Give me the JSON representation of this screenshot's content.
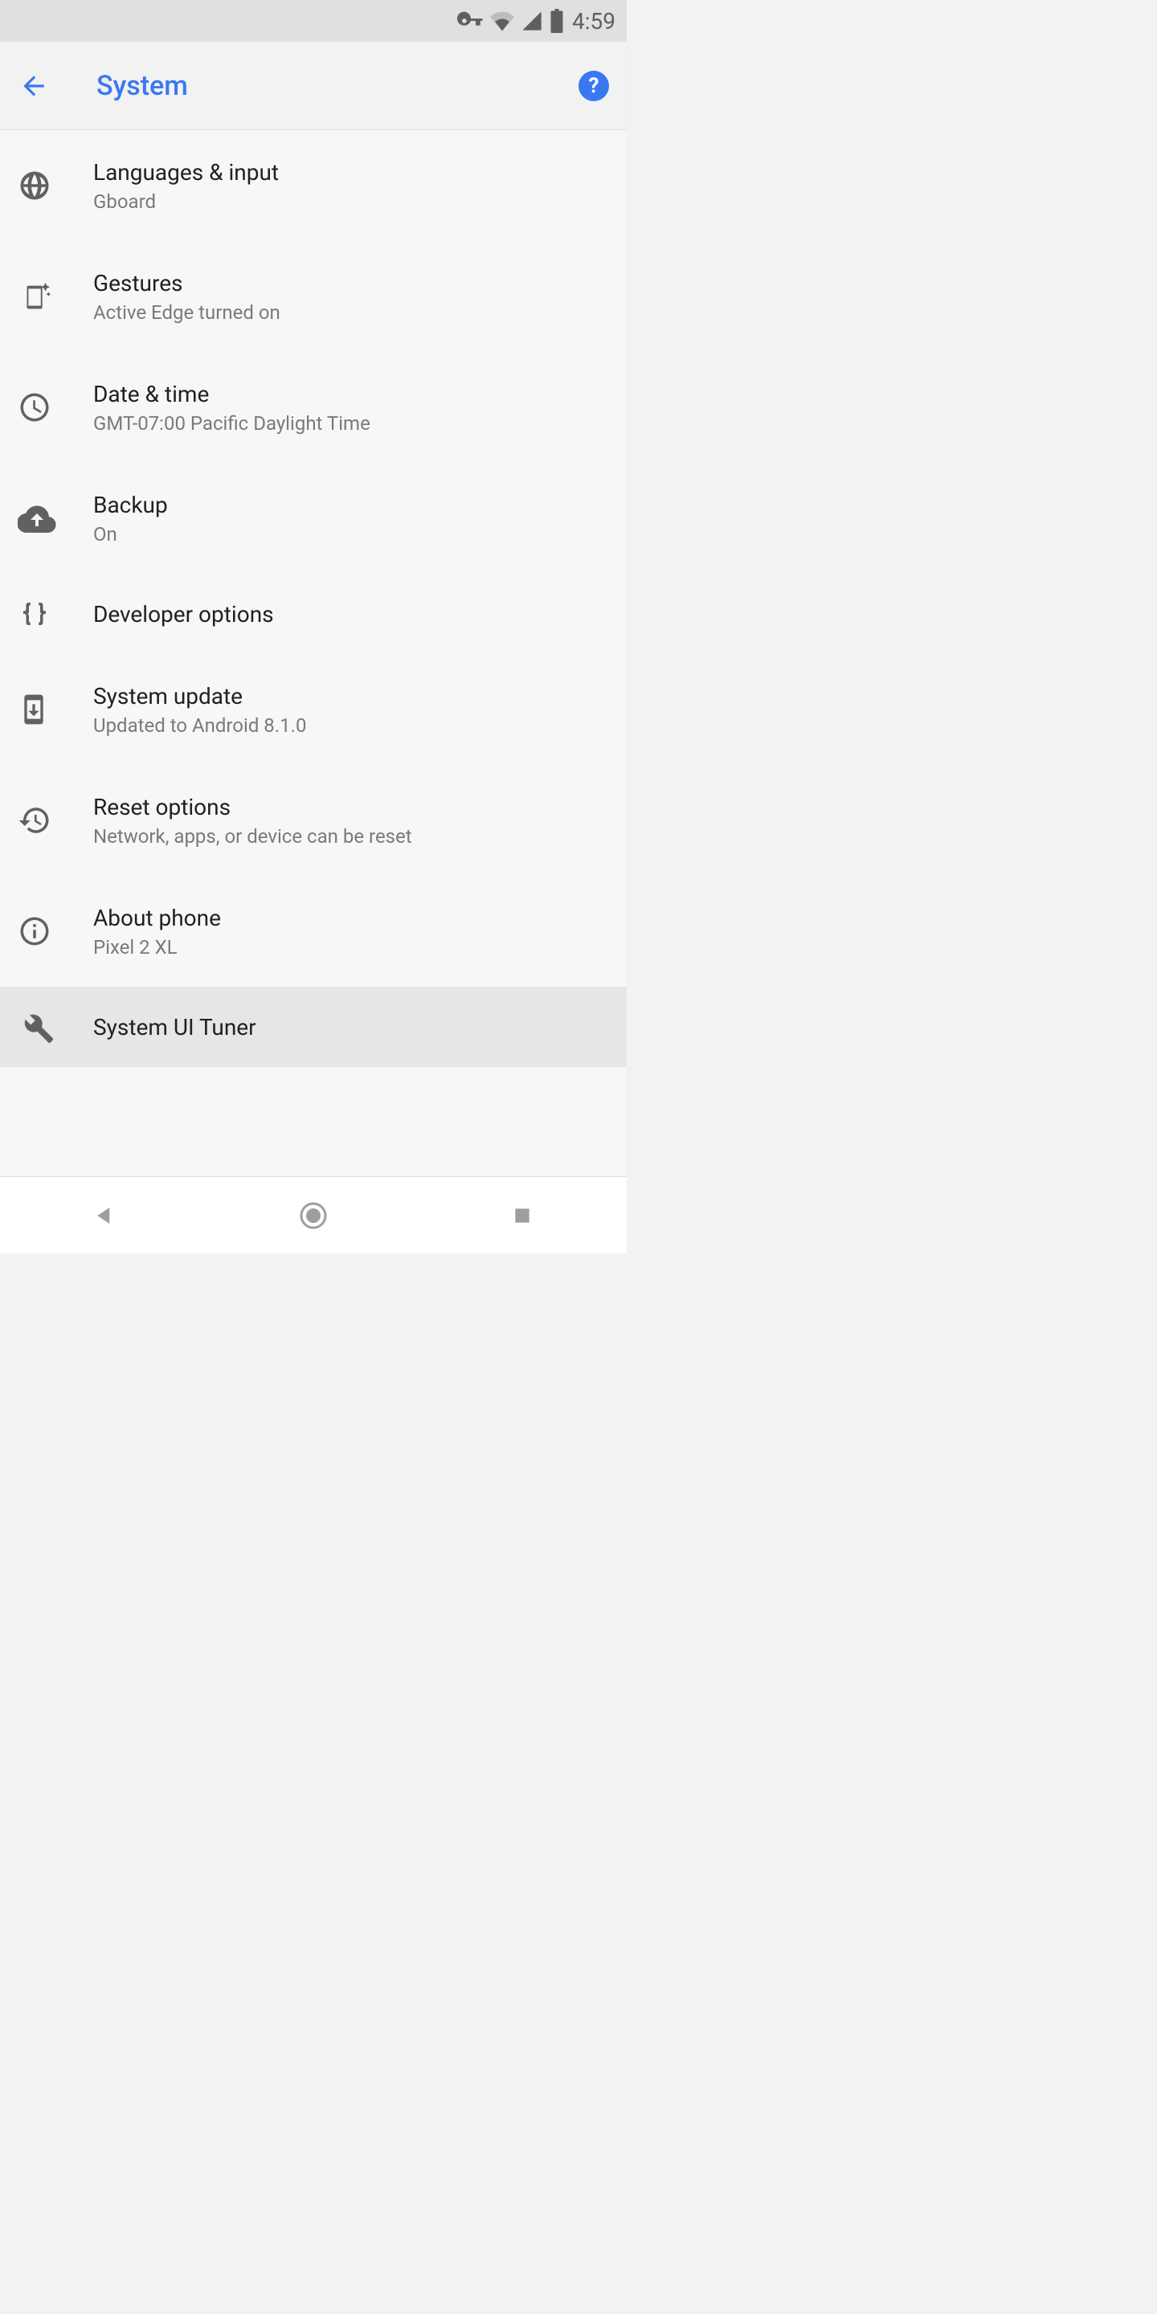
{
  "status_bar": {
    "time": "4:59"
  },
  "header": {
    "title": "System"
  },
  "items": [
    {
      "title": "Languages & input",
      "subtitle": "Gboard"
    },
    {
      "title": "Gestures",
      "subtitle": "Active Edge turned on"
    },
    {
      "title": "Date & time",
      "subtitle": "GMT-07:00 Pacific Daylight Time"
    },
    {
      "title": "Backup",
      "subtitle": "On"
    },
    {
      "title": "Developer options",
      "subtitle": ""
    },
    {
      "title": "System update",
      "subtitle": "Updated to Android 8.1.0"
    },
    {
      "title": "Reset options",
      "subtitle": "Network, apps, or device can be reset"
    },
    {
      "title": "About phone",
      "subtitle": "Pixel 2 XL"
    },
    {
      "title": "System UI Tuner",
      "subtitle": ""
    }
  ]
}
